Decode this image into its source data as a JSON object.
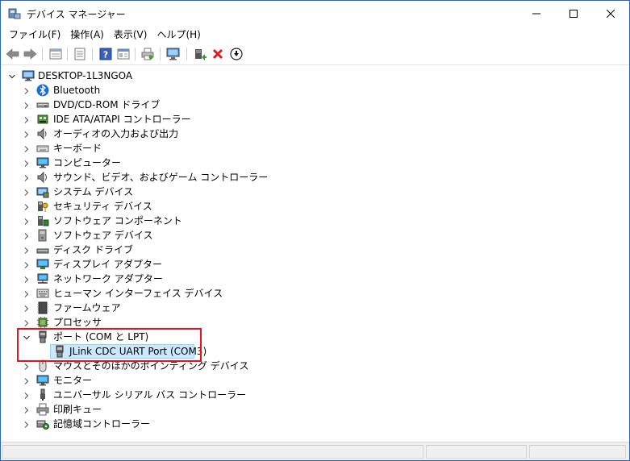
{
  "window": {
    "title": "デバイス マネージャー"
  },
  "menu": [
    "ファイル(F)",
    "操作(A)",
    "表示(V)",
    "ヘルプ(H)"
  ],
  "toolbar_icons": [
    "back-arrow-icon",
    "forward-arrow-icon",
    "show-hidden-icon",
    "properties-icon",
    "help-icon",
    "view-icon",
    "print-icon",
    "scan-hardware-icon",
    "update-driver-icon",
    "uninstall-icon",
    "disable-icon"
  ],
  "tree": {
    "root": "DESKTOP-1L3NGOA",
    "categories": [
      {
        "label": "Bluetooth",
        "icon": "bluetooth-icon"
      },
      {
        "label": "DVD/CD-ROM ドライブ",
        "icon": "dvd-drive-icon"
      },
      {
        "label": "IDE ATA/ATAPI コントローラー",
        "icon": "ide-controller-icon"
      },
      {
        "label": "オーディオの入力および出力",
        "icon": "audio-icon"
      },
      {
        "label": "キーボード",
        "icon": "keyboard-icon"
      },
      {
        "label": "コンピューター",
        "icon": "computer-icon"
      },
      {
        "label": "サウンド、ビデオ、およびゲーム コントローラー",
        "icon": "sound-icon"
      },
      {
        "label": "システム デバイス",
        "icon": "system-device-icon"
      },
      {
        "label": "セキュリティ デバイス",
        "icon": "security-device-icon"
      },
      {
        "label": "ソフトウェア コンポーネント",
        "icon": "software-component-icon"
      },
      {
        "label": "ソフトウェア デバイス",
        "icon": "software-device-icon"
      },
      {
        "label": "ディスク ドライブ",
        "icon": "disk-drive-icon"
      },
      {
        "label": "ディスプレイ アダプター",
        "icon": "display-adapter-icon"
      },
      {
        "label": "ネットワーク アダプター",
        "icon": "network-adapter-icon"
      },
      {
        "label": "ヒューマン インターフェイス デバイス",
        "icon": "hid-icon"
      },
      {
        "label": "ファームウェア",
        "icon": "firmware-icon"
      },
      {
        "label": "プロセッサ",
        "icon": "processor-icon"
      },
      {
        "label": "ポート (COM と LPT)",
        "icon": "port-icon",
        "expanded": true
      },
      {
        "label": "JLink CDC UART Port (COM3)",
        "icon": "port-device-icon",
        "child": true,
        "selected": true
      },
      {
        "label": "マウスとそのほかのポインティング デバイス",
        "icon": "mouse-icon"
      },
      {
        "label": "モニター",
        "icon": "monitor-icon"
      },
      {
        "label": "ユニバーサル シリアル バス コントローラー",
        "icon": "usb-icon"
      },
      {
        "label": "印刷キュー",
        "icon": "print-queue-icon"
      },
      {
        "label": "記憶域コントローラー",
        "icon": "storage-controller-icon"
      }
    ]
  }
}
